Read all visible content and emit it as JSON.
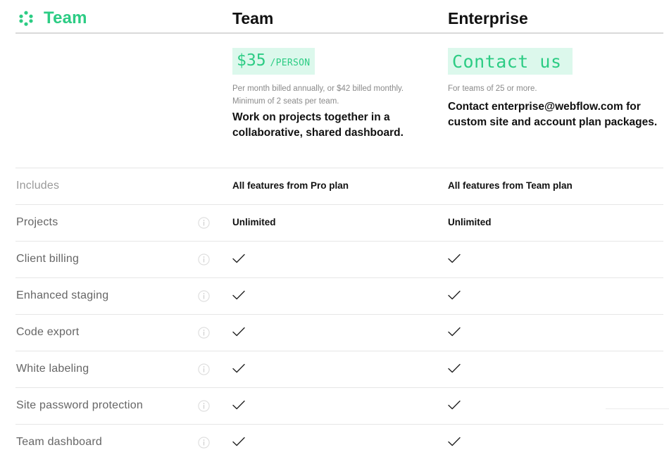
{
  "header": {
    "brand_icon": "dots-circle-icon",
    "brand_label": "Team",
    "brand_color": "#2ccc84",
    "columns": [
      "Team",
      "Enterprise"
    ]
  },
  "plans": [
    {
      "name": "Team",
      "price_amount": "$35",
      "price_unit": "/PERSON",
      "note_lines": [
        "Per month billed annually, or $42 billed monthly.",
        "Minimum of 2 seats per team."
      ],
      "description": "Work on projects together in a collaborative, shared dashboard."
    },
    {
      "name": "Enterprise",
      "price_label": "Contact us",
      "note_lines": [
        "For teams of 25 or more."
      ],
      "description": "Contact enterprise@webflow.com for custom site and account plan packages."
    }
  ],
  "colors": {
    "accent": "#2ccc84",
    "price_bg": "#dcf8ec",
    "divider": "#e6e6e6"
  },
  "features": [
    {
      "label": "Includes",
      "info": false,
      "team": "All features from Pro plan",
      "enterprise": "All features from Team plan"
    },
    {
      "label": "Projects",
      "info": true,
      "team": "Unlimited",
      "enterprise": "Unlimited"
    },
    {
      "label": "Client billing",
      "info": true,
      "team": "check",
      "enterprise": "check"
    },
    {
      "label": "Enhanced staging",
      "info": true,
      "team": "check",
      "enterprise": "check"
    },
    {
      "label": "Code export",
      "info": true,
      "team": "check",
      "enterprise": "check"
    },
    {
      "label": "White labeling",
      "info": true,
      "team": "check",
      "enterprise": "check"
    },
    {
      "label": "Site password protection",
      "info": true,
      "team": "check",
      "enterprise": "check"
    },
    {
      "label": "Team dashboard",
      "info": true,
      "team": "check",
      "enterprise": "check"
    }
  ]
}
